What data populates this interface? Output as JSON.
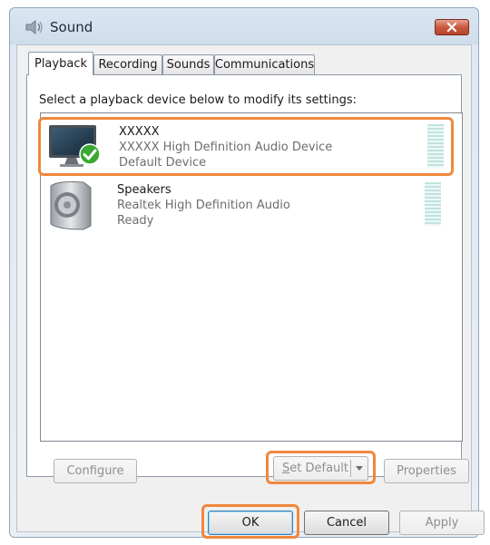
{
  "window": {
    "title": "Sound",
    "title_icon": "speaker-icon",
    "close_icon": "close-icon"
  },
  "tabs": [
    {
      "label": "Playback",
      "active": true
    },
    {
      "label": "Recording",
      "active": false
    },
    {
      "label": "Sounds",
      "active": false
    },
    {
      "label": "Communications",
      "active": false
    }
  ],
  "playback": {
    "instruction": "Select a playback device below to modify its settings:",
    "devices": [
      {
        "name": "XXXXX",
        "description": "XXXXX High Definition Audio Device",
        "status": "Default Device",
        "icon": "monitor-icon",
        "badge": "default-check-icon"
      },
      {
        "name": "Speakers",
        "description": "Realtek High Definition Audio",
        "status": "Ready",
        "icon": "speaker-device-icon"
      }
    ],
    "buttons": {
      "configure": "Configure",
      "set_default": "Set Default",
      "properties": "Properties"
    }
  },
  "footer": {
    "ok": "OK",
    "cancel": "Cancel",
    "apply": "Apply"
  },
  "colors": {
    "highlight": "#f0883c",
    "close_button": "#c85a3f",
    "check_badge": "#3aa832"
  }
}
